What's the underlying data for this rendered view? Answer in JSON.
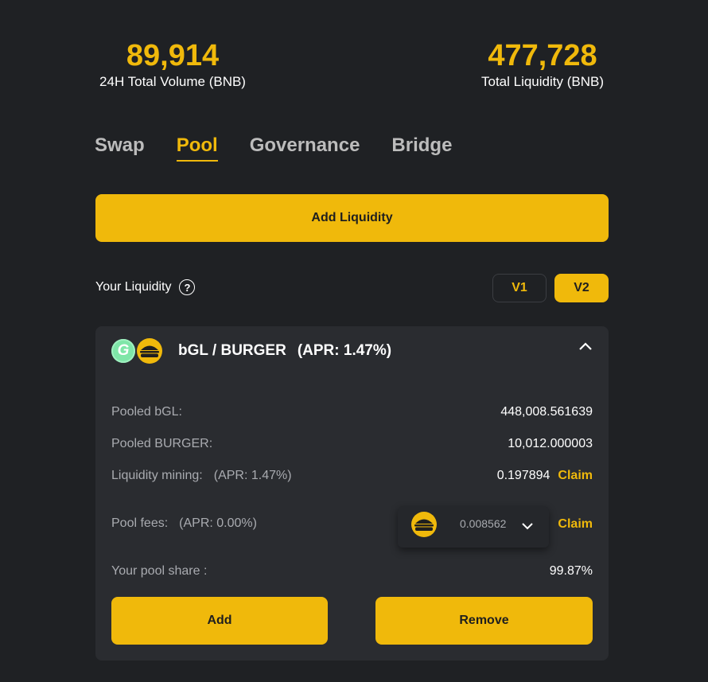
{
  "stats": {
    "volume_value": "89,914",
    "volume_label": "24H Total Volume (BNB)",
    "liquidity_value": "477,728",
    "liquidity_label": "Total Liquidity (BNB)"
  },
  "tabs": [
    {
      "label": "Swap",
      "active": false
    },
    {
      "label": "Pool",
      "active": true
    },
    {
      "label": "Governance",
      "active": false
    },
    {
      "label": "Bridge",
      "active": false
    }
  ],
  "add_liquidity_label": "Add Liquidity",
  "your_liquidity": {
    "label": "Your Liquidity",
    "help_icon": "?"
  },
  "versions": {
    "v1": "V1",
    "v2": "V2",
    "selected": "V2"
  },
  "pool": {
    "token_a_icon": "G",
    "pair": "bGL / BURGER",
    "apr": "(APR: 1.47%)",
    "rows": {
      "pooled_a_label": "Pooled bGL:",
      "pooled_a_value": "448,008.561639",
      "pooled_b_label": "Pooled BURGER:",
      "pooled_b_value": "10,012.000003",
      "mining_label": "Liquidity mining:",
      "mining_apr": "(APR: 1.47%)",
      "mining_value": "0.197894",
      "fees_label": "Pool fees:",
      "fees_apr": "(APR: 0.00%)",
      "fees_value": "0.008562",
      "share_label": "Your pool share :",
      "share_value": "99.87%"
    },
    "claim_label": "Claim",
    "add_label": "Add",
    "remove_label": "Remove"
  },
  "colors": {
    "accent": "#f0b90b",
    "background": "#1f2124",
    "card": "#2a2c30",
    "muted_text": "#a9abb0"
  }
}
